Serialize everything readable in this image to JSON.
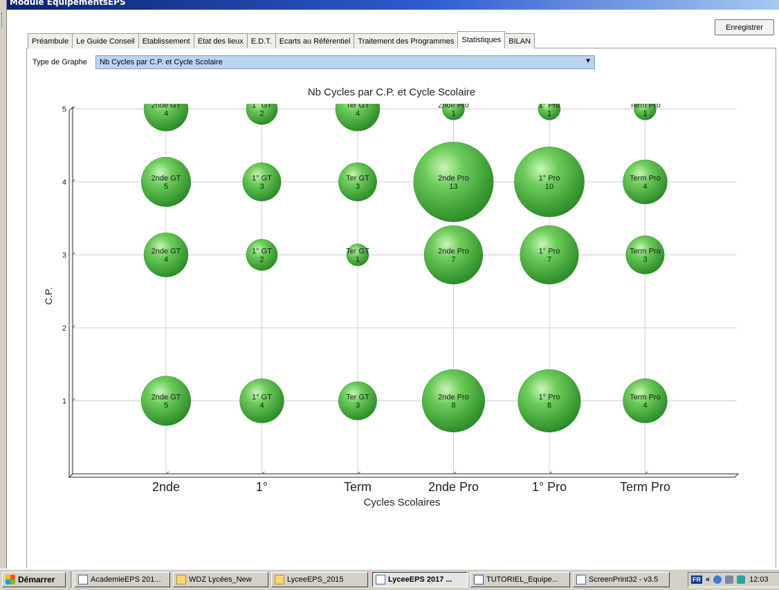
{
  "window": {
    "title": "Module EquipementsEPS"
  },
  "toolbar": {
    "save_label": "Enregistrer"
  },
  "tabs": [
    {
      "label": "Préambule"
    },
    {
      "label": "Le Guide Conseil"
    },
    {
      "label": "Etablissement"
    },
    {
      "label": "Etat des lieux"
    },
    {
      "label": "E.D.T."
    },
    {
      "label": "Ecarts au Référentiel"
    },
    {
      "label": "Traitement des Programmes"
    },
    {
      "label": "Statistiques",
      "active": true
    },
    {
      "label": "BILAN"
    }
  ],
  "graph_selector": {
    "label": "Type de Graphe",
    "value": "Nb Cycles par C.P. et Cycle Scolaire"
  },
  "chart_data": {
    "type": "bubble",
    "title": "Nb Cycles par C.P. et Cycle Scolaire",
    "xlabel": "Cycles Scolaires",
    "ylabel": "C.P.",
    "categories": [
      "2nde",
      "1°",
      "Term",
      "2nde Pro",
      "1° Pro",
      "Term Pro"
    ],
    "yticks": [
      1,
      2,
      3,
      4,
      5
    ],
    "ylim": [
      0,
      5
    ],
    "grid": true,
    "bubble_color": "#3fae3a",
    "points": [
      {
        "x": "2nde",
        "y": 5,
        "label": "2nde GT",
        "value": 4
      },
      {
        "x": "1°",
        "y": 5,
        "label": "1° GT",
        "value": 2
      },
      {
        "x": "Term",
        "y": 5,
        "label": "Ter GT",
        "value": 4
      },
      {
        "x": "2nde Pro",
        "y": 5,
        "label": "2nde Pro",
        "value": 1
      },
      {
        "x": "1° Pro",
        "y": 5,
        "label": "1° Pro",
        "value": 1
      },
      {
        "x": "Term Pro",
        "y": 5,
        "label": "Term Pro",
        "value": 1
      },
      {
        "x": "2nde",
        "y": 4,
        "label": "2nde GT",
        "value": 5
      },
      {
        "x": "1°",
        "y": 4,
        "label": "1° GT",
        "value": 3
      },
      {
        "x": "Term",
        "y": 4,
        "label": "Ter GT",
        "value": 3
      },
      {
        "x": "2nde Pro",
        "y": 4,
        "label": "2nde Pro",
        "value": 13
      },
      {
        "x": "1° Pro",
        "y": 4,
        "label": "1° Pro",
        "value": 10
      },
      {
        "x": "Term Pro",
        "y": 4,
        "label": "Term Pro",
        "value": 4
      },
      {
        "x": "2nde",
        "y": 3,
        "label": "2nde GT",
        "value": 4
      },
      {
        "x": "1°",
        "y": 3,
        "label": "1° GT",
        "value": 2
      },
      {
        "x": "Term",
        "y": 3,
        "label": "Ter GT",
        "value": 1
      },
      {
        "x": "2nde Pro",
        "y": 3,
        "label": "2nde Pro",
        "value": 7
      },
      {
        "x": "1° Pro",
        "y": 3,
        "label": "1° Pro",
        "value": 7
      },
      {
        "x": "Term Pro",
        "y": 3,
        "label": "Term Pro",
        "value": 3
      },
      {
        "x": "2nde",
        "y": 1,
        "label": "2nde GT",
        "value": 5
      },
      {
        "x": "1°",
        "y": 1,
        "label": "1° GT",
        "value": 4
      },
      {
        "x": "Term",
        "y": 1,
        "label": "Ter GT",
        "value": 3
      },
      {
        "x": "2nde Pro",
        "y": 1,
        "label": "2nde Pro",
        "value": 8
      },
      {
        "x": "1° Pro",
        "y": 1,
        "label": "1° Pro",
        "value": 8
      },
      {
        "x": "Term Pro",
        "y": 1,
        "label": "Term Pro",
        "value": 4
      }
    ]
  },
  "taskbar": {
    "start_label": "Démarrer",
    "tasks": [
      {
        "label": "AcademieEPS 201...",
        "icon": "app-icon"
      },
      {
        "label": "WDZ Lycées_New",
        "icon": "folder-icon"
      },
      {
        "label": "LyceeEPS_2015",
        "icon": "folder-icon"
      },
      {
        "label": "LyceeEPS 2017 ...",
        "icon": "app-icon",
        "active": true
      },
      {
        "label": "TUTORIEL_Equipe...",
        "icon": "word-icon"
      },
      {
        "label": "ScreenPrint32 - v3.5",
        "icon": "app-icon"
      }
    ],
    "tray": {
      "lang": "FR",
      "time": "12:03"
    }
  }
}
